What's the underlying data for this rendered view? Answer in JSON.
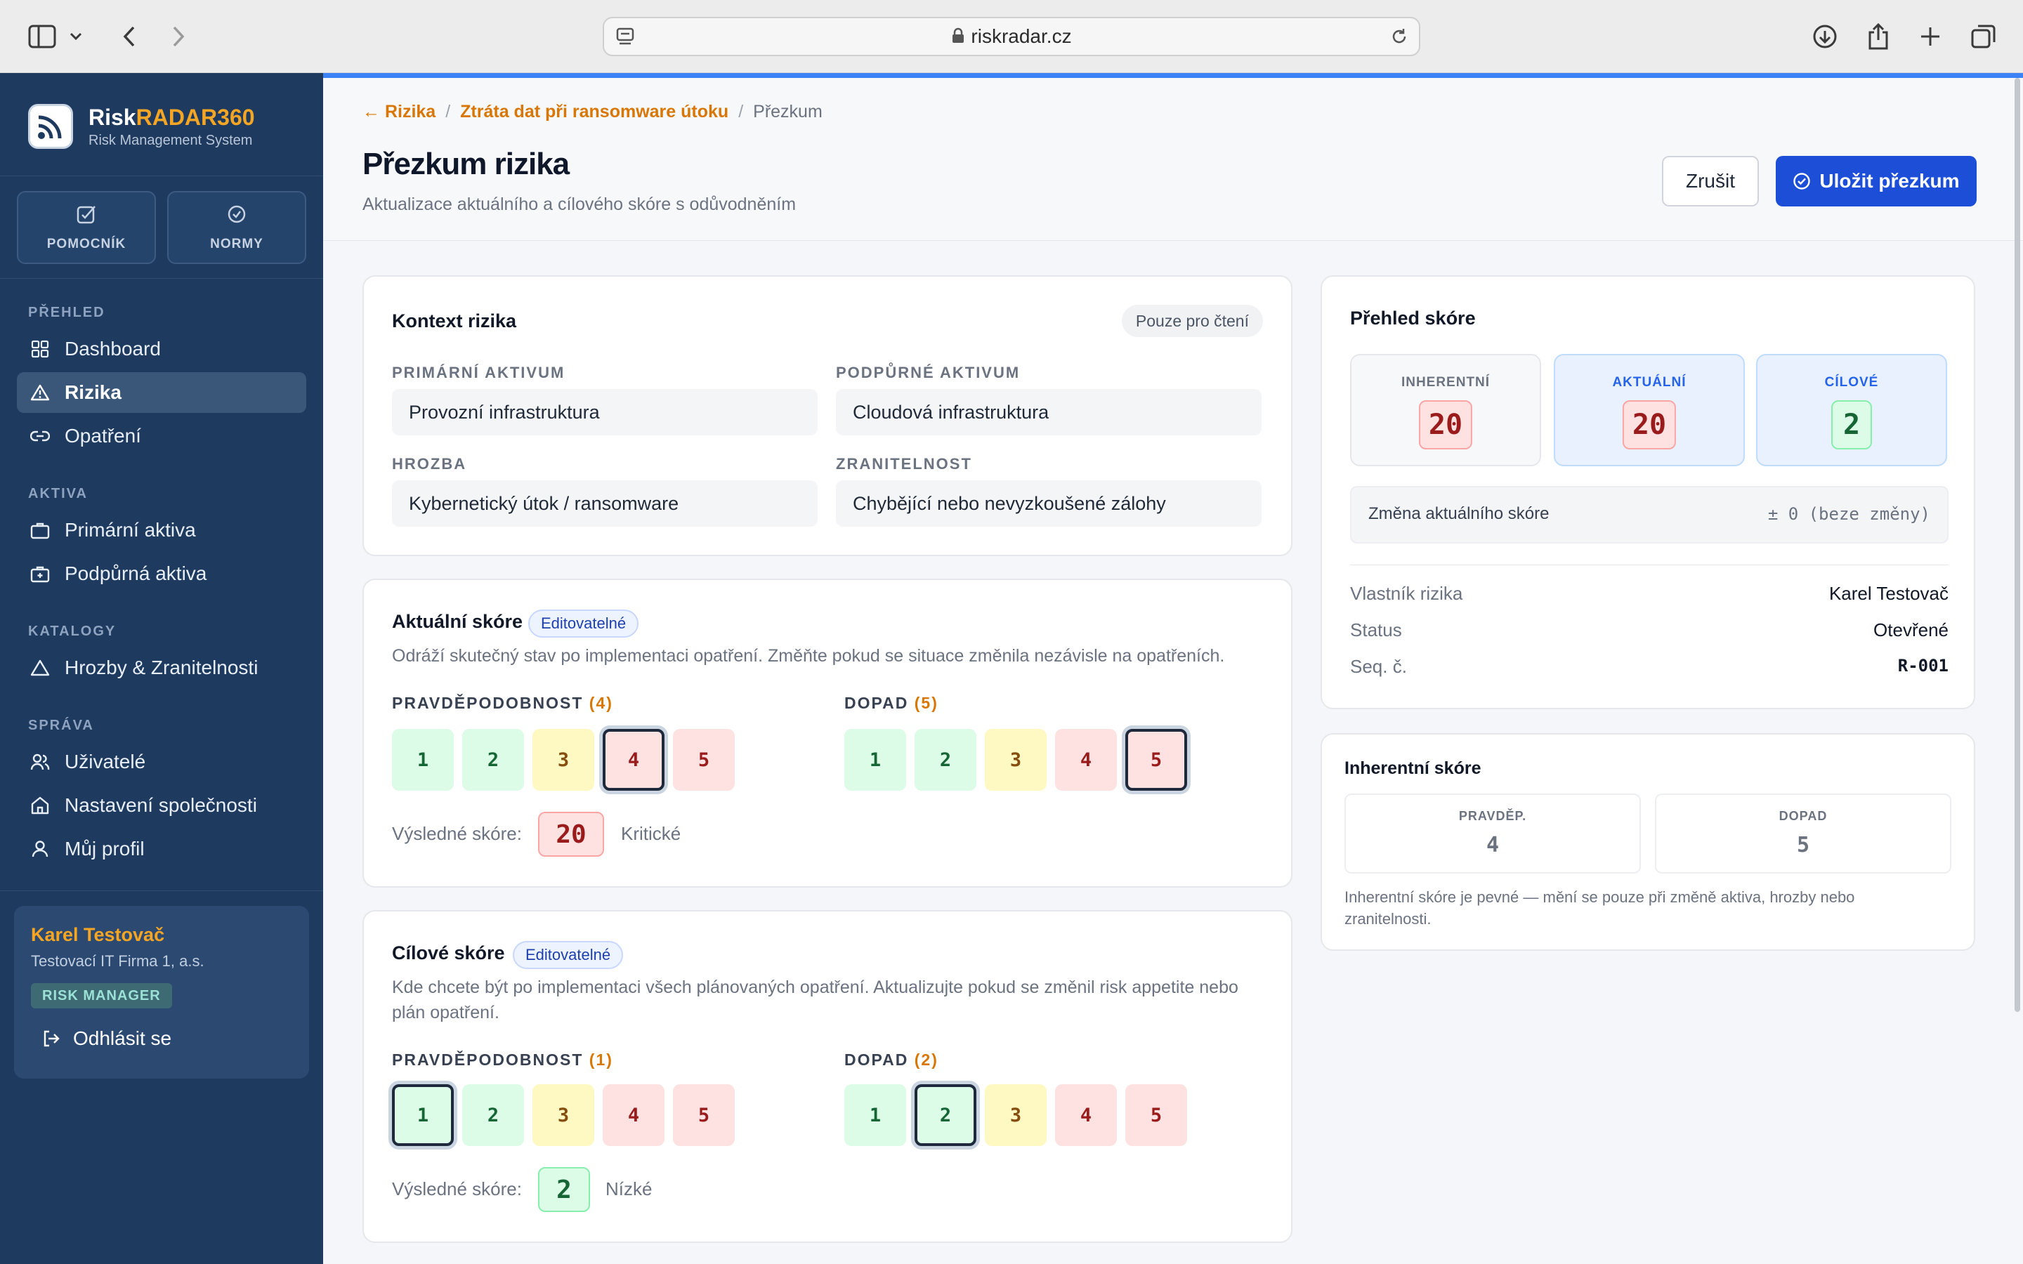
{
  "browser": {
    "url": "riskradar.cz"
  },
  "sidebar": {
    "brand_prefix": "Risk",
    "brand_accent": "RADAR360",
    "brand_sub": "Risk Management System",
    "tools": [
      "POMOCNÍK",
      "NORMY"
    ],
    "sections": {
      "overview": "PŘEHLED",
      "assets": "AKTIVA",
      "catalogs": "KATALOGY",
      "admin": "SPRÁVA"
    },
    "items": [
      {
        "label": "Dashboard",
        "icon": "grid-icon"
      },
      {
        "label": "Rizika",
        "icon": "warning-icon",
        "active": true
      },
      {
        "label": "Opatření",
        "icon": "link-icon"
      },
      {
        "label": "Primární aktiva",
        "icon": "briefcase-icon"
      },
      {
        "label": "Podpůrná aktiva",
        "icon": "briefcase-plus-icon"
      },
      {
        "label": "Hrozby & Zranitelnosti",
        "icon": "warning-icon"
      },
      {
        "label": "Uživatelé",
        "icon": "users-icon"
      },
      {
        "label": "Nastavení společnosti",
        "icon": "home-icon"
      },
      {
        "label": "Můj profil",
        "icon": "user-icon"
      }
    ],
    "user": {
      "name": "Karel Testovač",
      "company": "Testovací IT Firma 1, a.s.",
      "role": "RISK MANAGER",
      "logout": "Odhlásit se"
    }
  },
  "header": {
    "breadcrumb": [
      "← Rizika",
      "Ztráta dat při ransomware útoku",
      "Přezkum"
    ],
    "title": "Přezkum rizika",
    "subtitle": "Aktualizace aktuálního a cílového skóre s odůvodněním",
    "cancel": "Zrušit",
    "save": "Uložit přezkum"
  },
  "context": {
    "title": "Kontext rizika",
    "badge": "Pouze pro čtení",
    "fields": [
      {
        "label": "PRIMÁRNÍ AKTIVUM",
        "value": "Provozní infrastruktura"
      },
      {
        "label": "PODPŮRNÉ AKTIVUM",
        "value": "Cloudová infrastruktura"
      },
      {
        "label": "HROZBA",
        "value": "Kybernetický útok / ransomware"
      },
      {
        "label": "ZRANITELNOST",
        "value": "Chybějící nebo nevyzkoušené zálohy"
      }
    ]
  },
  "current": {
    "title": "Aktuální skóre",
    "badge": "Editovatelné",
    "desc": "Odráží skutečný stav po implementaci opatření. Změňte pokud se situace změnila nezávisle na opatřeních.",
    "prob_label": "PRAVDĚPODOBNOST",
    "prob_value": "(4)",
    "impact_label": "DOPAD",
    "impact_value": "(5)",
    "prob_selected": 4,
    "impact_selected": 5,
    "result_label": "Výsledné skóre:",
    "result": "20",
    "result_word": "Kritické"
  },
  "target": {
    "title": "Cílové skóre",
    "badge": "Editovatelné",
    "desc": "Kde chcete být po implementaci všech plánovaných opatření. Aktualizujte pokud se změnil risk appetite nebo plán opatření.",
    "prob_label": "PRAVDĚPODOBNOST",
    "prob_value": "(1)",
    "impact_label": "DOPAD",
    "impact_value": "(2)",
    "prob_selected": 1,
    "impact_selected": 2,
    "result_label": "Výsledné skóre:",
    "result": "2",
    "result_word": "Nízké"
  },
  "scale": [
    "1",
    "2",
    "3",
    "4",
    "5"
  ],
  "overview": {
    "title": "Přehled skóre",
    "tiles": [
      {
        "label": "INHERENTNÍ",
        "value": "20"
      },
      {
        "label": "AKTUÁLNÍ",
        "value": "20"
      },
      {
        "label": "CÍLOVÉ",
        "value": "2"
      }
    ],
    "change_label": "Změna aktuálního skóre",
    "change_value": "± 0 (beze změny)",
    "meta": [
      {
        "key": "Vlastník rizika",
        "value": "Karel Testovač"
      },
      {
        "key": "Status",
        "value": "Otevřené"
      },
      {
        "key": "Seq. č.",
        "value": "R-001"
      }
    ]
  },
  "inherent": {
    "title": "Inherentní skóre",
    "prob_label": "PRAVDĚP.",
    "prob_value": "4",
    "impact_label": "DOPAD",
    "impact_value": "5",
    "note": "Inherentní skóre je pevné — mění se pouze při změně aktiva, hrozby nebo zranitelnosti."
  },
  "colors": {
    "sidebar": "#1e3a5f",
    "accent": "#f5a524",
    "primary": "#1d4ed8"
  }
}
